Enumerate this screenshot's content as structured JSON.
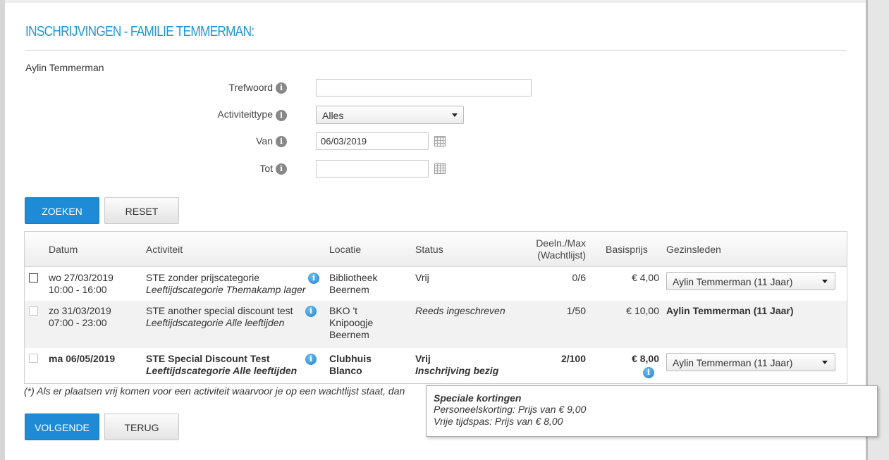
{
  "page": {
    "title": "INSCHRIJVINGEN - FAMILIE TEMMERMAN:",
    "person_name": "Aylin Temmerman"
  },
  "form": {
    "keyword_label": "Trefwoord",
    "keyword_value": "",
    "activity_type_label": "Activiteittype",
    "activity_type_value": "Alles",
    "from_label": "Van",
    "from_value": "06/03/2019",
    "to_label": "Tot",
    "to_value": "",
    "info_glyph": "i"
  },
  "buttons": {
    "search": "ZOEKEN",
    "reset": "RESET",
    "next": "VOLGENDE",
    "back": "TERUG"
  },
  "table": {
    "headers": {
      "date": "Datum",
      "activity": "Activiteit",
      "location": "Locatie",
      "status": "Status",
      "participants_line1": "Deeln./Max",
      "participants_line2": "(Wachtlijst)",
      "base_price": "Basisprijs",
      "family_members": "Gezinsleden"
    },
    "rows": [
      {
        "date": "wo 27/03/2019",
        "time": "10:00 - 16:00",
        "activity": "STE zonder prijscategorie",
        "category": "Leeftijdscategorie Themakamp lager",
        "location_line1": "Bibliotheek",
        "location_line2": "Beernem",
        "status": "Vrij",
        "participants": "0/6",
        "price": "€ 4,00",
        "member": "Aylin Temmerman (11 Jaar)"
      },
      {
        "date": "zo 31/03/2019",
        "time": "07:00 - 23:00",
        "activity": "STE another special discount test",
        "category": "Leeftijdscategorie Alle leeftijden",
        "location_line1": "BKO 't",
        "location_line2": "Knipoogje",
        "location_line3": "Beernem",
        "status": "Reeds ingeschreven",
        "participants": "1/50",
        "price": "€ 10,00",
        "member": "Aylin Temmerman (11 Jaar)"
      },
      {
        "date": "ma 06/05/2019",
        "activity": "STE Special Discount Test",
        "category": "Leeftijdscategorie Alle leeftijden",
        "location_line1": "Clubhuis",
        "location_line2": "Blanco",
        "status": "Vrij",
        "status_sub": "Inschrijving bezig",
        "participants": "2/100",
        "price": "€ 8,00",
        "member": "Aylin Temmerman (11 Jaar)"
      }
    ]
  },
  "footnote": "(*) Als er plaatsen vrij komen voor een activiteit waarvoor je op een wachtlijst staat, dan",
  "tooltip": {
    "title": "Speciale kortingen",
    "lines": [
      "Personeelskorting: Prijs van € 9,00",
      "Vrije tijdspas: Prijs van € 8,00"
    ]
  },
  "colors": {
    "accent": "#1e97d6",
    "primary_button": "#1f8ad6"
  }
}
